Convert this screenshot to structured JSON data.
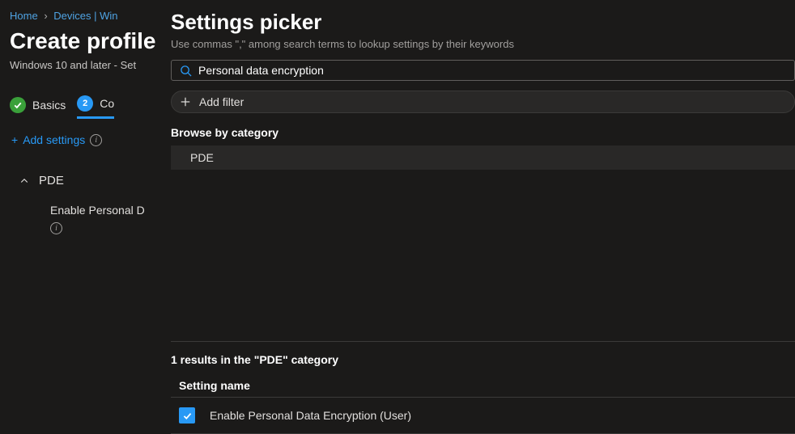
{
  "breadcrumb": {
    "home": "Home",
    "devices": "Devices | Win"
  },
  "page": {
    "title": "Create profile",
    "subtitle": "Windows 10 and later - Set"
  },
  "tabs": {
    "basics": "Basics",
    "config_num": "2",
    "config": "Co"
  },
  "sidebar": {
    "add_settings": "Add settings",
    "pde_label": "PDE",
    "pde_setting": "Enable Personal D"
  },
  "picker": {
    "title": "Settings picker",
    "subtitle": "Use commas \",\" among search terms to lookup settings by their keywords",
    "search_value": "Personal data encryption",
    "add_filter": "Add filter",
    "browse_label": "Browse by category",
    "category": "PDE",
    "results_count": "1 results in the \"PDE\" category",
    "column_header": "Setting name",
    "setting_0": "Enable Personal Data Encryption (User)"
  }
}
